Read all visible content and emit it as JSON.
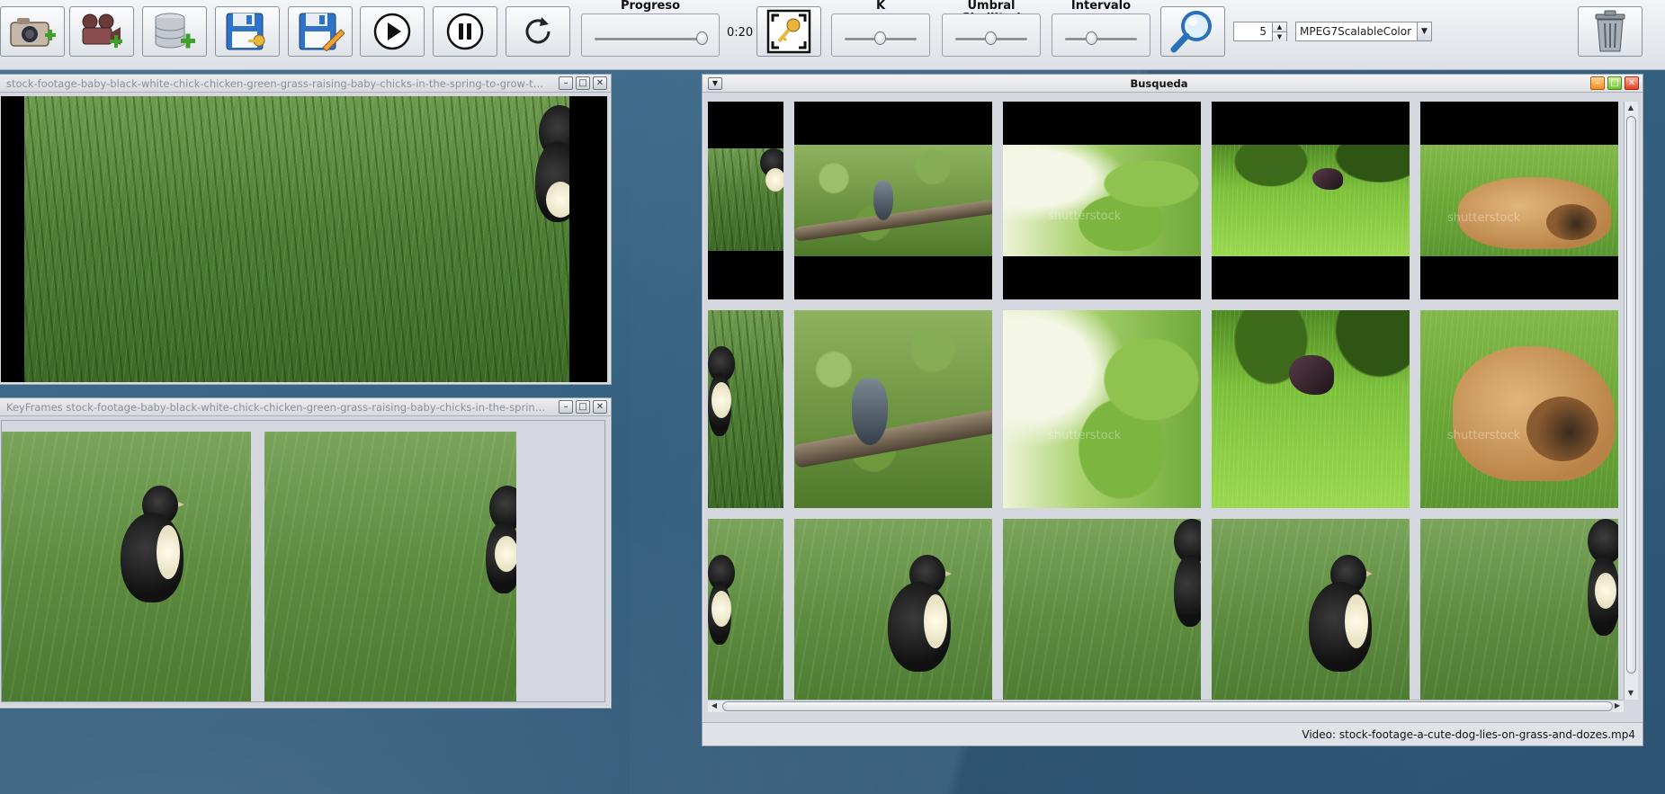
{
  "toolbar": {
    "buttons": [
      {
        "name": "add-image-button",
        "icon": "camera-add-icon"
      },
      {
        "name": "add-video-button",
        "icon": "video-camera-add-icon"
      },
      {
        "name": "add-database-button",
        "icon": "database-add-icon"
      },
      {
        "name": "save-key-button",
        "icon": "save-key-icon"
      },
      {
        "name": "save-edit-button",
        "icon": "save-edit-icon"
      },
      {
        "name": "play-button",
        "icon": "play-icon"
      },
      {
        "name": "pause-button",
        "icon": "pause-icon"
      },
      {
        "name": "restart-button",
        "icon": "refresh-icon"
      },
      {
        "name": "keyframe-button",
        "icon": "key-frame-icon"
      },
      {
        "name": "search-button",
        "icon": "magnifier-icon"
      },
      {
        "name": "delete-button",
        "icon": "trash-icon"
      }
    ],
    "progreso_label": "Progreso",
    "progreso_value": 0.97,
    "time": "0:20",
    "k_label": "K",
    "k_value": 0.5,
    "umbral_label": "Umbral Similitud",
    "umbral_value": 0.5,
    "intervalo_label": "Intervalo",
    "intervalo_value": 0.38,
    "spinner_value": "5",
    "descriptor": "MPEG7ScalableColor"
  },
  "player_window": {
    "title": "stock-footage-baby-black-white-chick-chicken-green-grass-raising-baby-chicks-in-the-spring-to-grow-th..."
  },
  "keyframes_window": {
    "title": "KeyFrames stock-footage-baby-black-white-chick-chicken-green-grass-raising-baby-chicks-in-the-spring..."
  },
  "search_window": {
    "title": "Busqueda",
    "watermark": "shutterstock",
    "status": "Video: stock-footage-a-cute-dog-lies-on-grass-and-dozes.mp4"
  },
  "colors": {
    "desktop": "#3d6585",
    "toolbar": "#e5e8ec",
    "frame": "#d4d8de"
  }
}
